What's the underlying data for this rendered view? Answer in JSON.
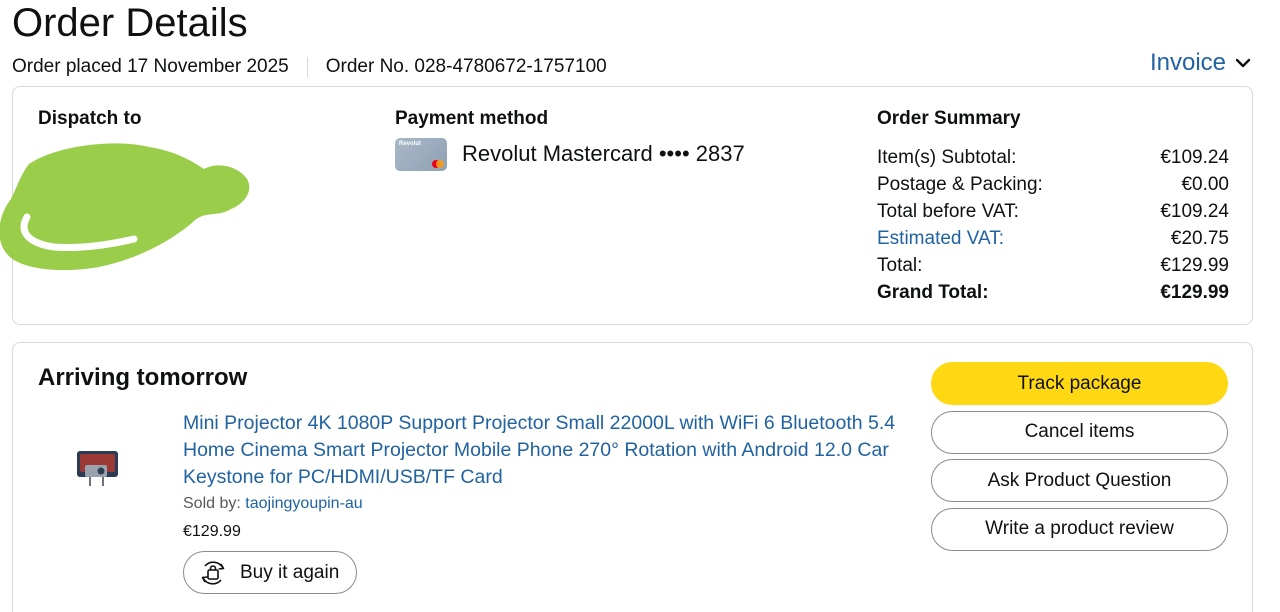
{
  "header": {
    "title": "Order Details",
    "order_placed": "Order placed 17 November 2025",
    "order_number": "Order No. 028-4780672-1757100",
    "invoice_label": "Invoice"
  },
  "dispatch": {
    "heading": "Dispatch to"
  },
  "payment": {
    "heading": "Payment method",
    "card_brand": "Revolut",
    "card_text": "Revolut Mastercard •••• 2837"
  },
  "summary": {
    "heading": "Order Summary",
    "rows": [
      {
        "label": "Item(s) Subtotal:",
        "value": "€109.24"
      },
      {
        "label": "Postage & Packing:",
        "value": "€0.00"
      },
      {
        "label": "Total before VAT:",
        "value": "€109.24"
      },
      {
        "label": "Estimated VAT:",
        "value": "€20.75"
      },
      {
        "label": "Total:",
        "value": "€129.99"
      },
      {
        "label": "Grand Total:",
        "value": "€129.99"
      }
    ]
  },
  "shipment": {
    "status": "Arriving tomorrow",
    "product_title": "Mini Projector 4K 1080P Support Projector Small 22000L with WiFi 6 Bluetooth 5.4 Home Cinema Smart Projector Mobile Phone 270° Rotation with Android 12.0 Car Keystone for PC/HDMI/USB/TF Card",
    "sold_by_label": "Sold by: ",
    "seller": "taojingyoupin-au",
    "price": "€129.99",
    "buy_again_label": "Buy it again",
    "actions": {
      "track": "Track package",
      "cancel": "Cancel items",
      "ask": "Ask Product Question",
      "review": "Write a product review"
    }
  },
  "colors": {
    "link": "#2162a1",
    "primary_button": "#ffd814",
    "redaction": "#9acd4a"
  },
  "icons": [
    "chevron-down-icon",
    "mastercard-icon",
    "buy-again-icon",
    "product-thumbnail"
  ]
}
